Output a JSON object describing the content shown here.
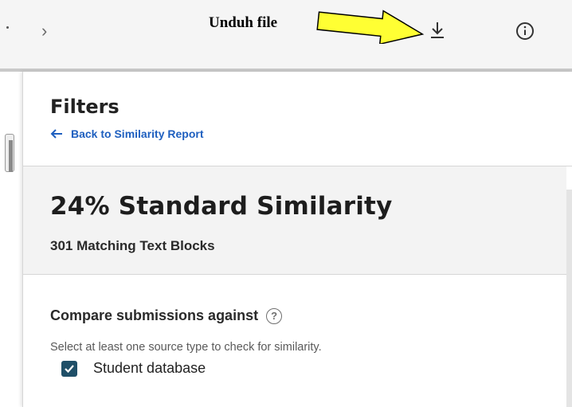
{
  "annotation": {
    "text": "Unduh file"
  },
  "icons": {
    "chevron": "chevron-right-icon",
    "download": "download-icon",
    "info": "info-icon",
    "back": "arrow-left-icon",
    "help": "help-icon",
    "check": "check-icon"
  },
  "colors": {
    "arrow_fill": "#ffff33",
    "link": "#1e5fbf",
    "checkbox": "#1f4f68",
    "summary_bg": "#f3f3f3"
  },
  "filters": {
    "title": "Filters",
    "back_label": "Back to Similarity Report"
  },
  "summary": {
    "similarity": "24% Standard Similarity",
    "matching_blocks": "301 Matching Text Blocks"
  },
  "compare": {
    "heading": "Compare submissions against",
    "description": "Select at least one source type to check for similarity.",
    "options": [
      {
        "label": "Student database",
        "checked": true
      }
    ]
  }
}
